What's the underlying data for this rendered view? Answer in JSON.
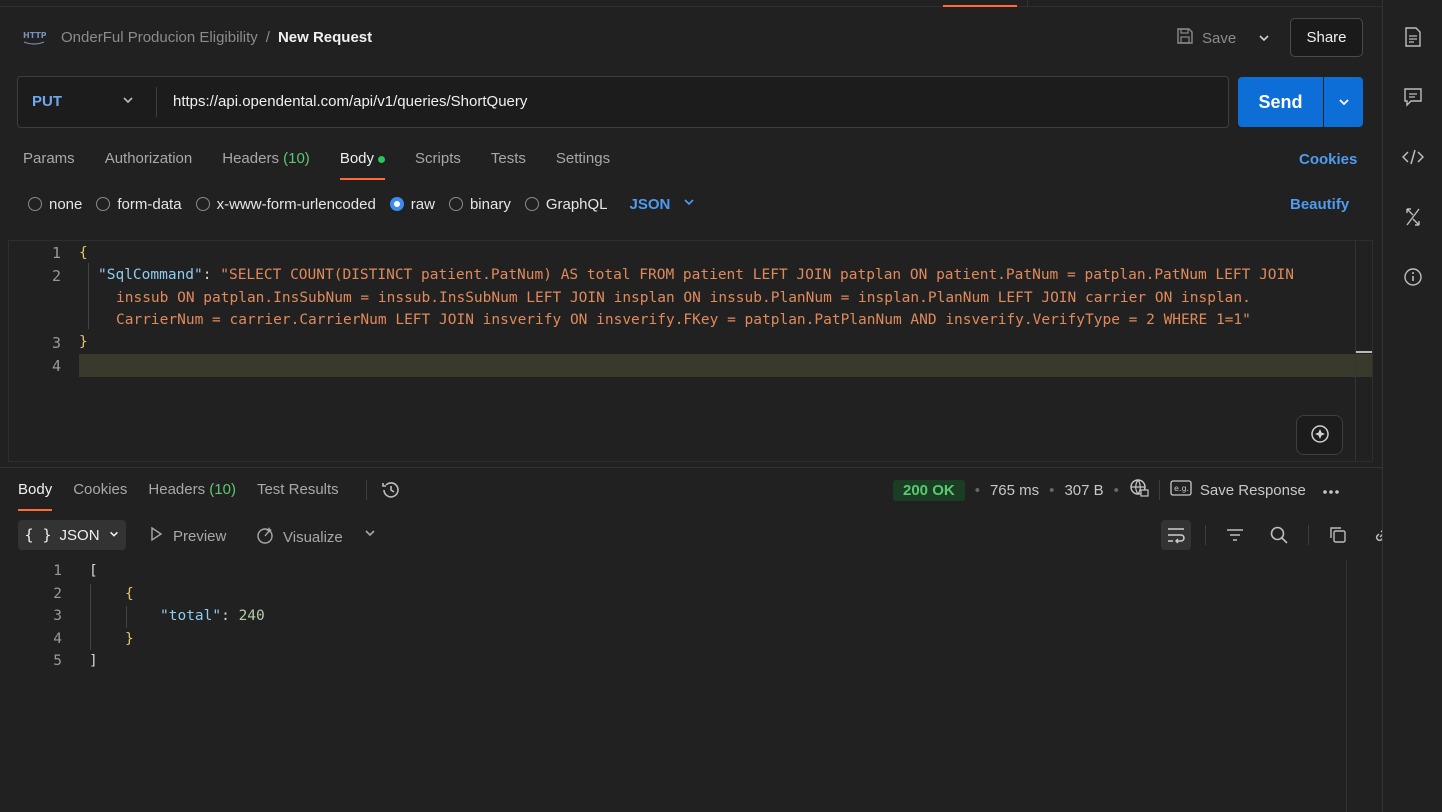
{
  "header": {
    "breadcrumb_parent": "OnderFul Producion Eligibility",
    "breadcrumb_sep": "/",
    "breadcrumb_current": "New Request",
    "save_label": "Save",
    "share_label": "Share"
  },
  "request": {
    "method": "PUT",
    "url": "https://api.opendental.com/api/v1/queries/ShortQuery",
    "send_label": "Send"
  },
  "req_tabs": {
    "params": "Params",
    "authorization": "Authorization",
    "headers": "Headers",
    "headers_count": "(10)",
    "body": "Body",
    "scripts": "Scripts",
    "tests": "Tests",
    "settings": "Settings",
    "cookies": "Cookies"
  },
  "body_types": {
    "none": "none",
    "form_data": "form-data",
    "urlencoded": "x-www-form-urlencoded",
    "raw": "raw",
    "binary": "binary",
    "graphql": "GraphQL",
    "format": "JSON",
    "beautify": "Beautify"
  },
  "editor": {
    "line_numbers": [
      "1",
      "2",
      "3",
      "4"
    ],
    "open_brace": "{",
    "key": "\"SqlCommand\"",
    "colon": ": ",
    "value_line1": "\"SELECT COUNT(DISTINCT patient.PatNum) AS total FROM patient LEFT JOIN patplan ON patient.PatNum = patplan.PatNum LEFT JOIN",
    "value_line2": "inssub ON patplan.InsSubNum = inssub.InsSubNum LEFT JOIN insplan ON inssub.PlanNum = insplan.PlanNum LEFT JOIN carrier ON insplan.",
    "value_line3": "CarrierNum = carrier.CarrierNum LEFT JOIN insverify ON insverify.FKey = patplan.PatPlanNum AND insverify.VerifyType = 2 WHERE 1=1\"",
    "close_brace": "}"
  },
  "resp_tabs": {
    "body": "Body",
    "cookies": "Cookies",
    "headers": "Headers",
    "headers_count": "(10)",
    "test_results": "Test Results"
  },
  "status": {
    "code": "200 OK",
    "time": "765 ms",
    "size": "307 B",
    "save_response": "Save Response"
  },
  "resp_toolbar": {
    "format": "JSON",
    "preview": "Preview",
    "visualize": "Visualize"
  },
  "response": {
    "line_numbers": [
      "1",
      "2",
      "3",
      "4",
      "5"
    ],
    "open_bracket": "[",
    "open_brace": "{",
    "key": "\"total\"",
    "colon": ": ",
    "value": "240",
    "close_brace": "}",
    "close_bracket": "]"
  },
  "colors": {
    "accent": "#ff6c37",
    "send": "#0d6ed8",
    "link": "#4e9bf0",
    "success": "#5cc873"
  }
}
